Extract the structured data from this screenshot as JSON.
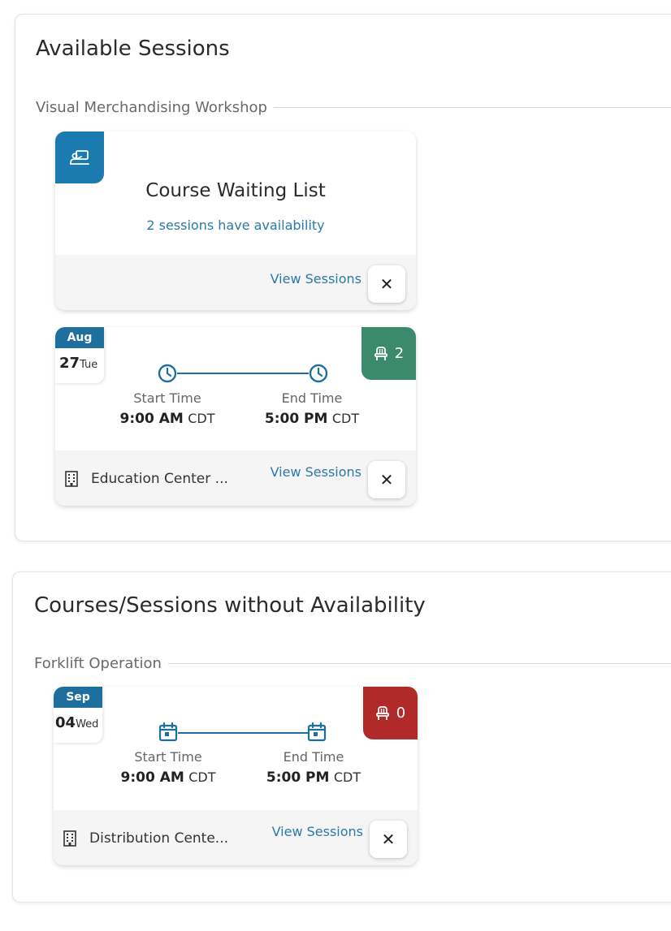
{
  "available": {
    "title": "Available Sessions",
    "group_label": "Visual Merchandising Workshop",
    "waiting_card": {
      "icon": "classroom-icon",
      "title": "Course Waiting List",
      "subtitle": "2 sessions have availability",
      "view_label": "View Sessions",
      "close_label": "✕"
    },
    "session_card": {
      "month": "Aug",
      "day": "27",
      "weekday": "Tue",
      "seats": "2",
      "seat_color": "#3b8a6e",
      "start_label": "Start Time",
      "start_time": "9:00 AM",
      "start_tz": "CDT",
      "end_label": "End Time",
      "end_time": "5:00 PM",
      "end_tz": "CDT",
      "location": "Education Center ...",
      "view_label": "View Sessions",
      "close_label": "✕",
      "time_icon": "clock-icon"
    }
  },
  "without": {
    "title": "Courses/Sessions without Availability",
    "group_label": "Forklift Operation",
    "session_card": {
      "month": "Sep",
      "day": "04",
      "weekday": "Wed",
      "seats": "0",
      "seat_color": "#b02a2a",
      "start_label": "Start Time",
      "start_time": "9:00 AM",
      "start_tz": "CDT",
      "end_label": "End Time",
      "end_time": "5:00 PM",
      "end_tz": "CDT",
      "location": "Distribution Cente...",
      "view_label": "View Sessions",
      "close_label": "✕",
      "time_icon": "calendar-icon"
    }
  },
  "colors": {
    "accent": "#1f6f9e",
    "link": "#2a7aa8",
    "available_seats": "#3b8a6e",
    "no_seats": "#b02a2a"
  }
}
